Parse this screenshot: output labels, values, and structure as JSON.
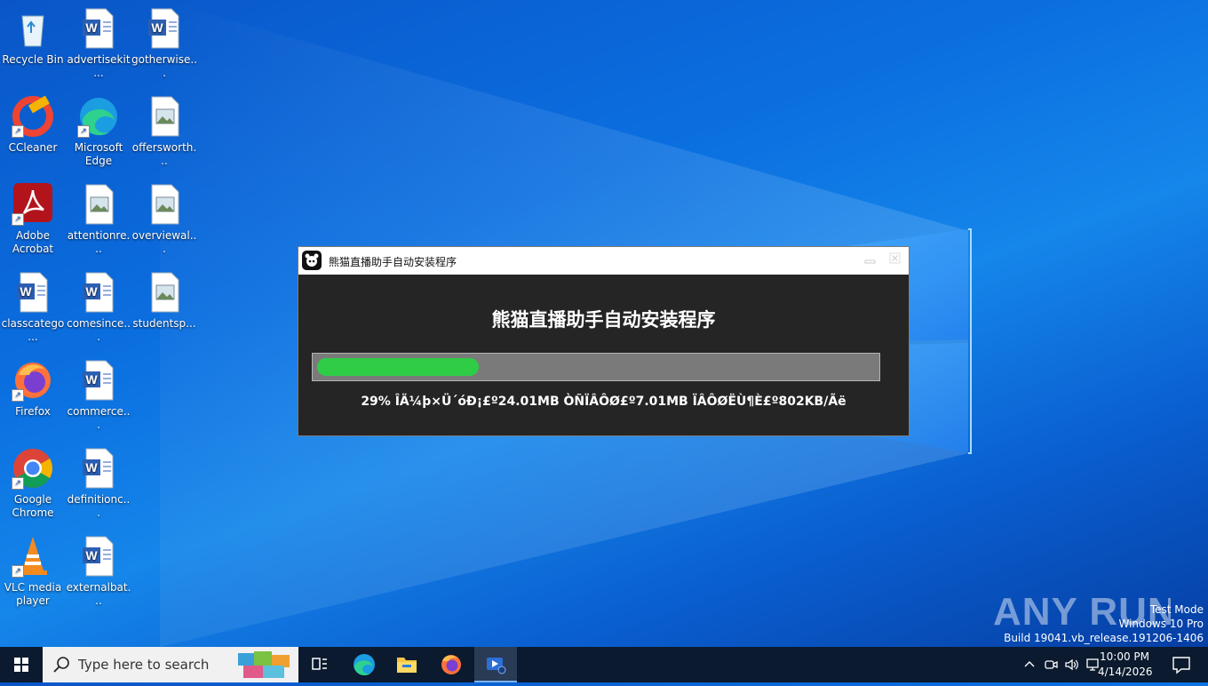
{
  "desktop": {
    "icons": [
      {
        "label": "Recycle Bin"
      },
      {
        "label": "advertisekit..."
      },
      {
        "label": "gotherwise..."
      },
      {
        "label": "CCleaner"
      },
      {
        "label": "Microsoft Edge"
      },
      {
        "label": "offersworth..."
      },
      {
        "label": "Adobe Acrobat"
      },
      {
        "label": "attentionre..."
      },
      {
        "label": "overviewal..."
      },
      {
        "label": "classcatego..."
      },
      {
        "label": "comesince..."
      },
      {
        "label": "studentsp..."
      },
      {
        "label": "Firefox"
      },
      {
        "label": "commerce..."
      },
      {
        "label": "Google Chrome"
      },
      {
        "label": "definitionc..."
      },
      {
        "label": "VLC media player"
      },
      {
        "label": "externalbat..."
      }
    ]
  },
  "dialog": {
    "title": "熊猫直播助手自动安装程序",
    "heading": "熊猫直播助手自动安装程序",
    "progress_percent": 29,
    "status_text": "29% ÎÄ¼þ×Ü´óÐ¡£º24.01MB ÒÑÏÂÔØ£º7.01MB ÏÂÔØËÙ¶È£º802KB/Ãë"
  },
  "watermark": {
    "text": "ANY RUN"
  },
  "system_info": {
    "line1": "Test Mode",
    "line2": "Windows 10 Pro",
    "line3": "Build 19041.vb_release.191206-1406"
  },
  "taskbar": {
    "search_placeholder": "Type here to search",
    "time": "10:00 PM",
    "date": "4/14/2026"
  },
  "colors": {
    "progress_fill": "#2fcc46",
    "dialog_bg": "#252525",
    "taskbar_bg": "#0b1a2e"
  }
}
